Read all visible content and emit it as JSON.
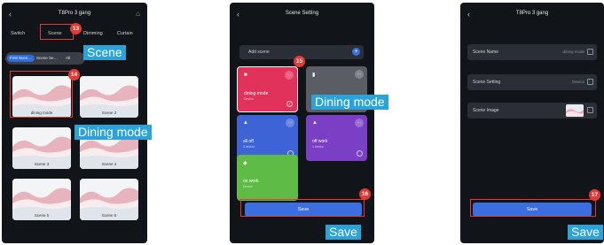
{
  "screen1": {
    "title": "T8Pro 3 gang",
    "tabs": [
      "Switch",
      "Scene",
      "Dimming",
      "Curtain"
    ],
    "chips": [
      "First Scen…",
      "Scene Se…",
      "All"
    ],
    "scenes": [
      "dining mode",
      "Scene 2",
      "Scene 3",
      "Scene 4",
      "Scene 5",
      "Scene 6"
    ]
  },
  "screen2": {
    "title": "Scene Setting",
    "add_scene": "Add scene",
    "tiles": [
      {
        "name": "dining mode",
        "sub": "Device",
        "color": "#e0325a"
      },
      {
        "name": "",
        "sub": "",
        "color": "#5a5d63"
      },
      {
        "name": "all off",
        "sub": "3 device",
        "color": "#3d63d6"
      },
      {
        "name": "off work",
        "sub": "1 device",
        "color": "#7a3fc4"
      },
      {
        "name": "on work",
        "sub": "Device",
        "color": "#5ebb45"
      }
    ],
    "save": "Save"
  },
  "screen3": {
    "title": "T8Pro 3 gang",
    "rows": [
      {
        "label": "Scene Name",
        "value": "dining mode"
      },
      {
        "label": "Scene Setting",
        "value": "Device"
      },
      {
        "label": "Scene Image",
        "value": ""
      }
    ],
    "save": "Save"
  },
  "annotations": {
    "badge_13": "13",
    "badge_14": "14",
    "badge_15": "15",
    "badge_16": "16",
    "badge_17": "17",
    "callout_scene": "Scene",
    "callout_dining_1": "Dining mode",
    "callout_dining_2": "Dining mode",
    "callout_save_1": "Save",
    "callout_save_2": "Save"
  },
  "colors": {
    "accent_red": "#e53935",
    "callout_blue": "#2aa4d8",
    "button_blue": "#3b6fe0"
  }
}
